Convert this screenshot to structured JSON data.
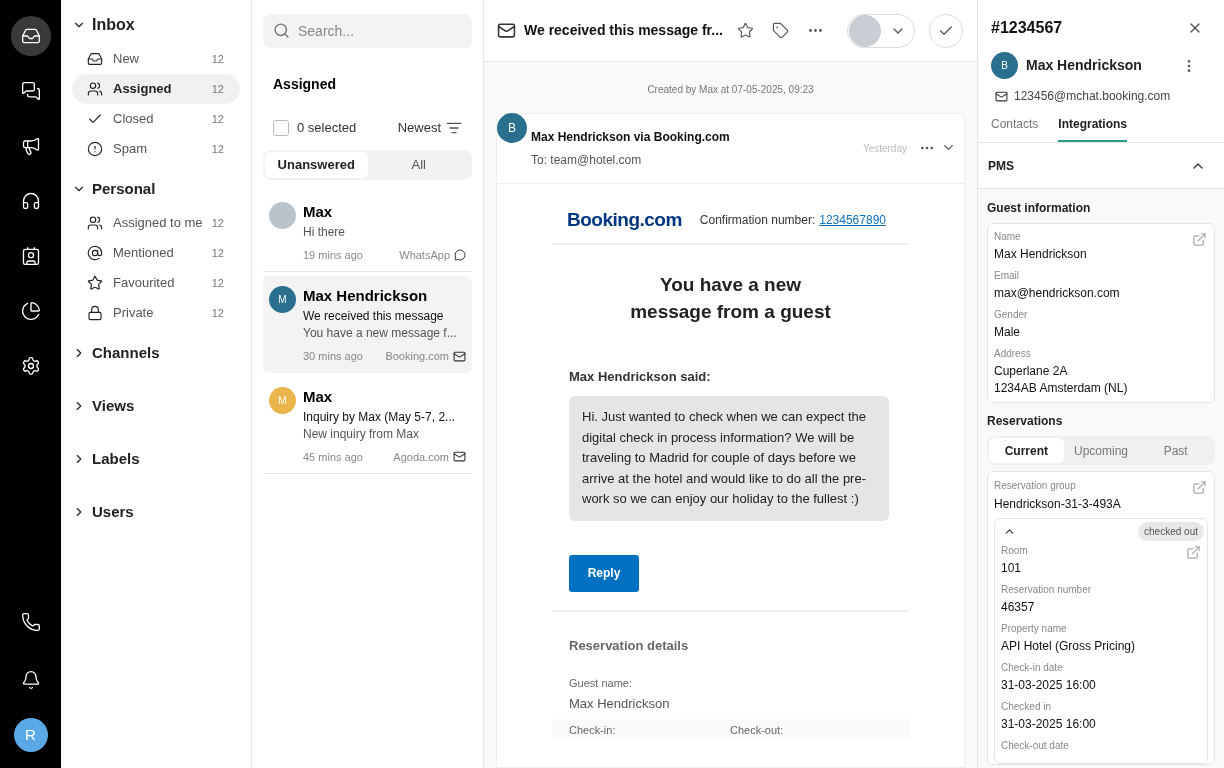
{
  "rail": {
    "items": [
      {
        "selected": true
      },
      {
        "selected": false
      },
      {
        "selected": false
      },
      {
        "selected": false
      },
      {
        "selected": false
      },
      {
        "selected": false
      },
      {
        "selected": false
      }
    ],
    "user_initial": "R"
  },
  "nav": {
    "sections": [
      {
        "title": "Inbox",
        "expanded": true,
        "items": [
          {
            "label": "New",
            "count": "12",
            "selected": false
          },
          {
            "label": "Assigned",
            "count": "12",
            "selected": true
          },
          {
            "label": "Closed",
            "count": "12",
            "selected": false
          },
          {
            "label": "Spam",
            "count": "12",
            "selected": false
          }
        ]
      },
      {
        "title": "Personal",
        "expanded": true,
        "items": [
          {
            "label": "Assigned to me",
            "count": "12",
            "selected": false
          },
          {
            "label": "Mentioned",
            "count": "12",
            "selected": false
          },
          {
            "label": "Favourited",
            "count": "12",
            "selected": false
          },
          {
            "label": "Private",
            "count": "12",
            "selected": false
          }
        ]
      },
      {
        "title": "Channels",
        "expanded": false
      },
      {
        "title": "Views",
        "expanded": false
      },
      {
        "title": "Labels",
        "expanded": false
      },
      {
        "title": "Users",
        "expanded": false
      }
    ]
  },
  "list": {
    "search": {
      "placeholder": "Search..."
    },
    "title": "Assigned",
    "select_all": {
      "label": "0 selected",
      "checked": false
    },
    "sort": "Newest",
    "filters": [
      {
        "label": "Unanswered",
        "selected": true
      },
      {
        "label": "All",
        "selected": false
      }
    ],
    "conversations": [
      {
        "kind": "photo",
        "name": "Max",
        "subject": "Hi there",
        "time": "19 mins ago",
        "channel": {
          "name": "WhatsApp",
          "kind": "chat"
        },
        "selected": false
      },
      {
        "kind": "letter",
        "initial": "M",
        "color": "#2b6f8f",
        "name": "Max Hendrickson",
        "subject": "We received this message",
        "preview": "You have a new message f...",
        "time": "30 mins ago",
        "channel": {
          "name": "Booking.com",
          "kind": "email"
        },
        "selected": true
      },
      {
        "kind": "letter",
        "initial": "M",
        "color": "#eab54b",
        "name": "Max",
        "subject": "Inquiry by Max (May 5-7, 2...",
        "preview": "New inquiry from Max",
        "time": "45 mins ago",
        "channel": {
          "name": "Agoda.com",
          "kind": "email"
        },
        "selected": false
      }
    ]
  },
  "conversation": {
    "title": "We received this message fr...",
    "note": "Created by Max at 07-05-2025, 09:23",
    "email": {
      "sender_initial": "B",
      "sender": "Max Hendrickson via Booking.com",
      "to": "To: team@hotel.com",
      "time": "Yesterday",
      "logo": "Booking.com",
      "confirmation_label": "Confirmation number:",
      "confirmation_number": "1234567890",
      "heading": "You have a new\nmessage from a guest",
      "said": "Max Hendrickson said:",
      "message": "Hi. Just wanted to check when we can expect the digital check in process information? We will be traveling to Madrid for couple of days before we arrive at the hotel and would like to do all the pre-work so we can enjoy our holiday to the fullest :)",
      "reply_button": "Reply",
      "details_title": "Reservation details",
      "guest_name_label": "Guest name:",
      "guest_name": "Max Hendrickson",
      "check_in_label": "Check-in:",
      "check_out_label": "Check-out:"
    }
  },
  "details": {
    "ticket": "#1234567",
    "contact": {
      "initial": "B",
      "name": "Max Hendrickson",
      "email": "123456@mchat.booking.com"
    },
    "tabs": [
      {
        "label": "Contacts",
        "selected": false
      },
      {
        "label": "Integrations",
        "selected": true
      }
    ],
    "pms": {
      "title": "PMS",
      "expanded": true,
      "guest_title": "Guest information",
      "guest_fields": [
        {
          "label": "Name",
          "value": "Max Hendrickson"
        },
        {
          "label": "Email",
          "value": "max@hendrickson.com"
        },
        {
          "label": "Gender",
          "value": "Male"
        },
        {
          "label": "Address",
          "value": "Cuperlane 2A\n1234AB Amsterdam (NL)"
        }
      ],
      "reservations_title": "Reservations",
      "reservation_tabs": [
        {
          "label": "Current",
          "selected": true
        },
        {
          "label": "Upcoming",
          "selected": false
        },
        {
          "label": "Past",
          "selected": false
        }
      ],
      "group_label": "Reservation group",
      "group_value": "Hendrickson-31-3-493A",
      "reservation": {
        "expanded": true,
        "status": "checked out",
        "fields": [
          {
            "label": "Room",
            "value": "101"
          },
          {
            "label": "Reservation number",
            "value": "46357"
          },
          {
            "label": "Property name",
            "value": "API Hotel (Gross Pricing)"
          },
          {
            "label": "Check-in date",
            "value": "31-03-2025 16:00"
          },
          {
            "label": "Checked in",
            "value": "31-03-2025 16:00"
          },
          {
            "label": "Check-out date"
          }
        ]
      }
    }
  }
}
